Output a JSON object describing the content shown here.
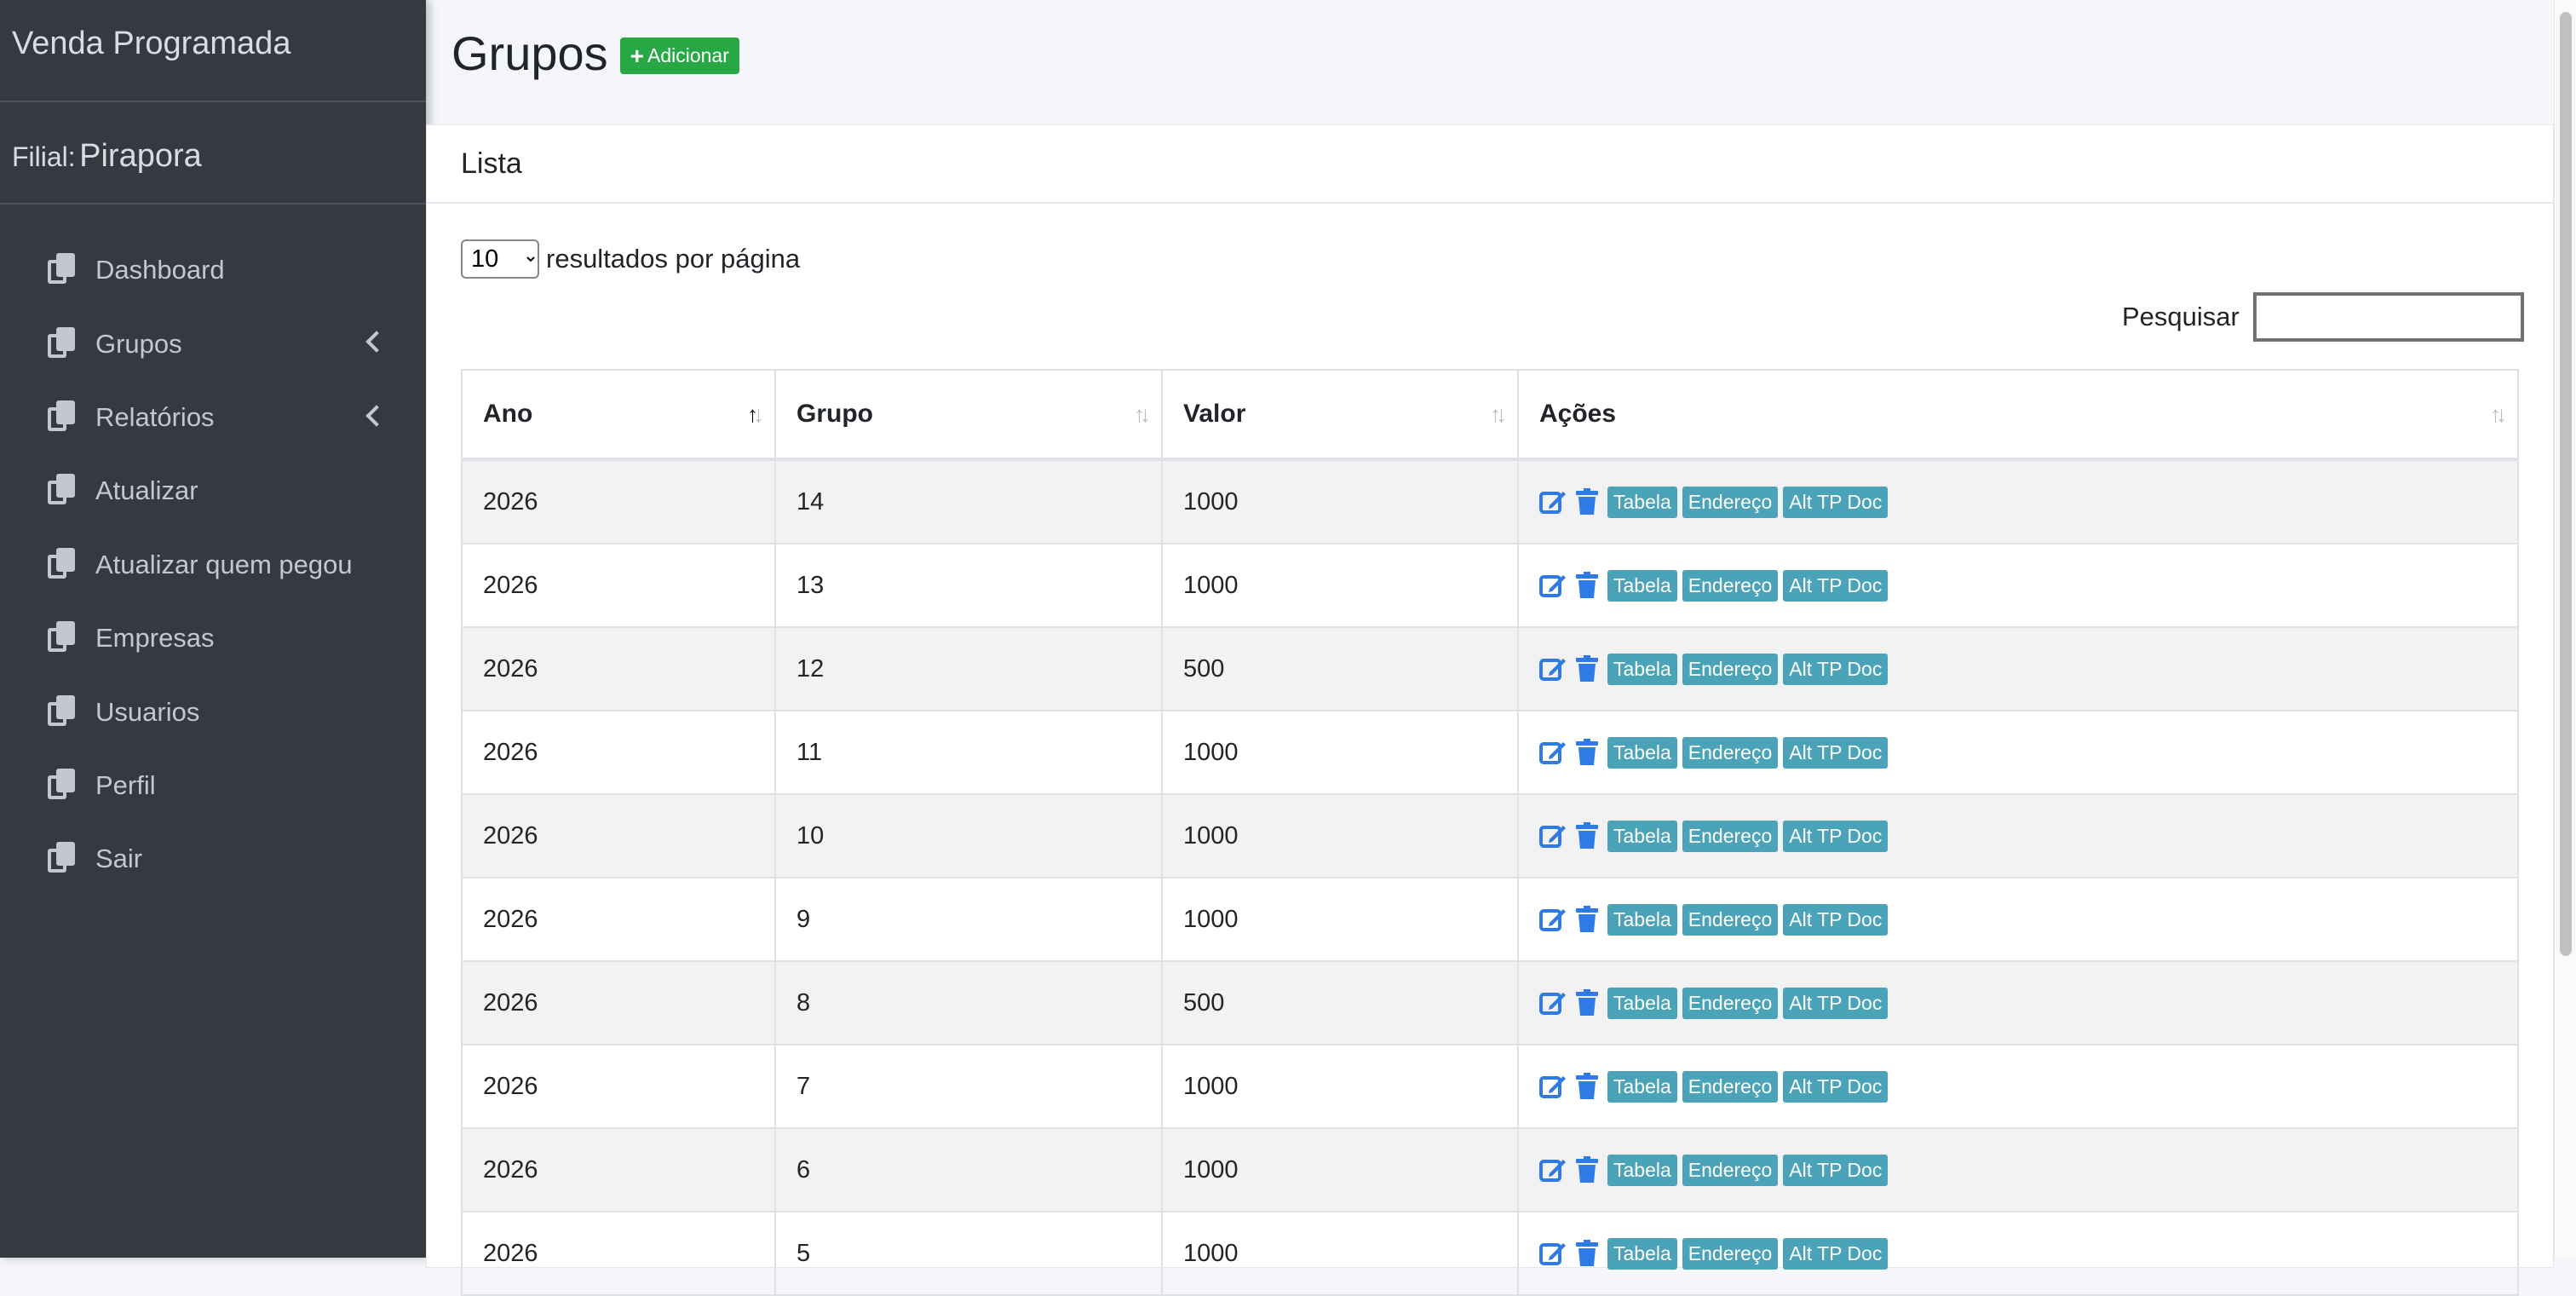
{
  "sidebar": {
    "brand": "Venda Programada",
    "filial_label": "Filial:",
    "filial_value": "Pirapora",
    "items": [
      {
        "label": "Dashboard"
      },
      {
        "label": "Grupos"
      },
      {
        "label": "Relatórios"
      },
      {
        "label": "Atualizar"
      },
      {
        "label": "Atualizar quem pegou"
      },
      {
        "label": "Empresas"
      },
      {
        "label": "Usuarios"
      },
      {
        "label": "Perfil"
      },
      {
        "label": "Sair"
      }
    ]
  },
  "header": {
    "title": "Grupos",
    "add_label": "Adicionar"
  },
  "card": {
    "title": "Lista"
  },
  "controls": {
    "page_length_value": "10",
    "page_length_suffix": "resultados por página",
    "search_label": "Pesquisar",
    "search_value": ""
  },
  "table": {
    "columns": [
      "Ano",
      "Grupo",
      "Valor",
      "Ações"
    ],
    "action_labels": {
      "tabela": "Tabela",
      "endereco": "Endereço",
      "alt": "Alt TP Doc"
    },
    "rows": [
      {
        "ano": "2026",
        "grupo": "14",
        "valor": "1000"
      },
      {
        "ano": "2026",
        "grupo": "13",
        "valor": "1000"
      },
      {
        "ano": "2026",
        "grupo": "12",
        "valor": "500"
      },
      {
        "ano": "2026",
        "grupo": "11",
        "valor": "1000"
      },
      {
        "ano": "2026",
        "grupo": "10",
        "valor": "1000"
      },
      {
        "ano": "2026",
        "grupo": "9",
        "valor": "1000"
      },
      {
        "ano": "2026",
        "grupo": "8",
        "valor": "500"
      },
      {
        "ano": "2026",
        "grupo": "7",
        "valor": "1000"
      },
      {
        "ano": "2026",
        "grupo": "6",
        "valor": "1000"
      },
      {
        "ano": "2026",
        "grupo": "5",
        "valor": "1000"
      }
    ]
  },
  "colors": {
    "sidebar_bg": "#343a40",
    "add_button": "#28a745",
    "tag": "#4aa3b8",
    "icon_blue": "#2f7be6"
  }
}
